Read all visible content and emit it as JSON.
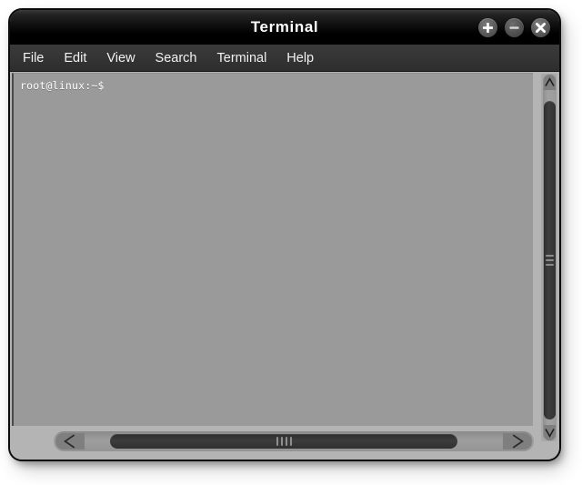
{
  "window": {
    "title": "Terminal",
    "controls": [
      {
        "name": "maximize",
        "glyph": "+",
        "label": "Maximize"
      },
      {
        "name": "minimize",
        "glyph": "−",
        "label": "Minimize"
      },
      {
        "name": "close",
        "glyph": "✕",
        "label": "Close"
      }
    ]
  },
  "menu": {
    "items": [
      {
        "label": "File"
      },
      {
        "label": "Edit"
      },
      {
        "label": "View"
      },
      {
        "label": "Search"
      },
      {
        "label": "Terminal"
      },
      {
        "label": "Help"
      }
    ]
  },
  "terminal": {
    "prompt": "root@linux:~$",
    "lines": [
      "root@linux:~$"
    ],
    "background_color": "#9a9a9a",
    "text_color": "#ffffff"
  },
  "scrollbars": {
    "vertical": {
      "up_arrow_icon": "chevron-up-icon",
      "down_arrow_icon": "chevron-down-icon",
      "thumb_position_percent": 8,
      "thumb_size_percent": 87
    },
    "horizontal": {
      "left_arrow_icon": "chevron-left-icon",
      "right_arrow_icon": "chevron-right-icon",
      "thumb_position_percent": 12,
      "thumb_size_percent": 72
    }
  },
  "colors": {
    "titlebar": "#000000",
    "menubar": "#333333",
    "frame": "#b4b4b4",
    "terminal_bg": "#9a9a9a",
    "scroll_thumb": "#333333"
  }
}
